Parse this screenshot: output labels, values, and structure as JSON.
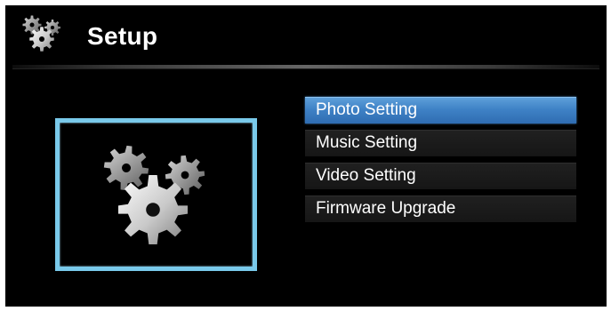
{
  "header": {
    "title": "Setup",
    "icon": "gears-icon"
  },
  "preview": {
    "icon": "gears-icon",
    "frame_color": "#79c9ea"
  },
  "menu": {
    "items": [
      {
        "label": "Photo Setting",
        "selected": true
      },
      {
        "label": "Music Setting",
        "selected": false
      },
      {
        "label": "Video Setting",
        "selected": false
      },
      {
        "label": "Firmware Upgrade",
        "selected": false
      }
    ],
    "selected_color": "#3f82c6"
  }
}
